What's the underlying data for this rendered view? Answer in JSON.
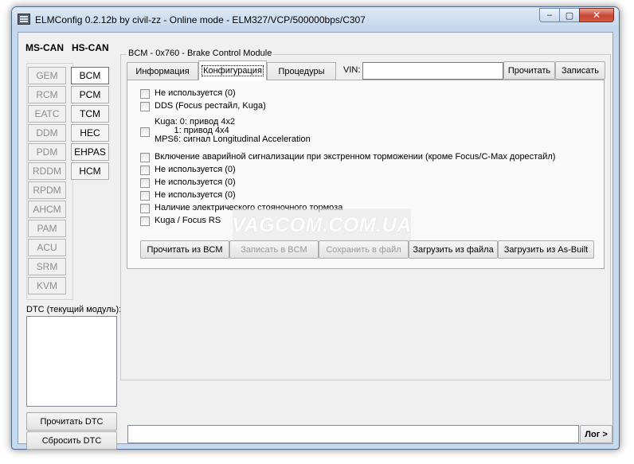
{
  "window": {
    "title": "ELMConfig 0.2.12b by civil-zz - Online mode - ELM327/VCP/500000bps/C307",
    "minimize": "–",
    "maximize": "▢",
    "close": "✕"
  },
  "ms_can": {
    "header": "MS-CAN",
    "modules": [
      "GEM",
      "RCM",
      "EATC",
      "DDM",
      "PDM",
      "RDDM",
      "RPDM",
      "AHCM",
      "PAM",
      "ACU",
      "SRM",
      "KVM"
    ]
  },
  "hs_can": {
    "header": "HS-CAN",
    "modules": [
      "BCM",
      "PCM",
      "TCM",
      "HEC",
      "EHPAS",
      "HCM"
    ],
    "active": "BCM"
  },
  "dtc": {
    "label": "DTC (текущий модуль):",
    "read_button": "Прочитать DTC",
    "clear_button": "Сбросить DTC"
  },
  "module": {
    "title": "BCM - 0x760 - Brake Control Module",
    "tabs": [
      "Информация",
      "Конфигурация",
      "Процедуры"
    ],
    "selected_tab": "Конфигурация",
    "vin_label": "VIN:",
    "vin_value": "",
    "read_button": "Прочитать",
    "write_button": "Записать"
  },
  "config": {
    "options": [
      "Не используется (0)",
      "DDS (Focus рестайл, Kuga)",
      "Kuga: 0: привод 4x2",
      "        1: привод 4x4",
      "MPS6: сигнал Longitudinal Acceleration",
      "Включение аварийной сигнализации при экстренном торможении (кроме Focus/C-Max дорестайл)",
      "Не используется (0)",
      "Не используется (0)",
      "Не используется (0)",
      "Наличие электрического стояночного тормоза",
      "Kuga / Focus RS"
    ],
    "buttons": {
      "read_bcm": "Прочитать из BCM",
      "write_bcm": "Записать в BCM",
      "save_file": "Сохранить в файл",
      "load_file": "Загрузить из файла",
      "load_asbuilt": "Загрузить из As-Built"
    }
  },
  "watermark": "VAGCOM.COM.UA",
  "footer": {
    "log_button": "Лог >",
    "status_value": ""
  }
}
